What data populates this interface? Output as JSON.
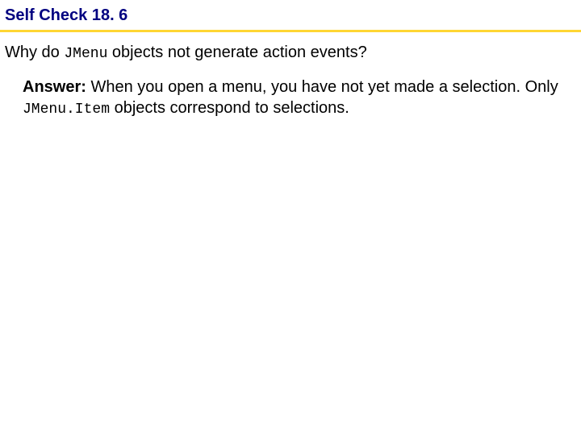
{
  "header": {
    "title": "Self Check 18. 6"
  },
  "question": {
    "prefix": "Why do ",
    "code": "JMenu",
    "suffix": " objects not generate action events?"
  },
  "answer": {
    "label": "Answer:",
    "text_before_code": " When you open a menu, you have not yet made a selection. Only ",
    "code": "JMenu.Item",
    "text_after_code": " objects correspond to selections."
  }
}
